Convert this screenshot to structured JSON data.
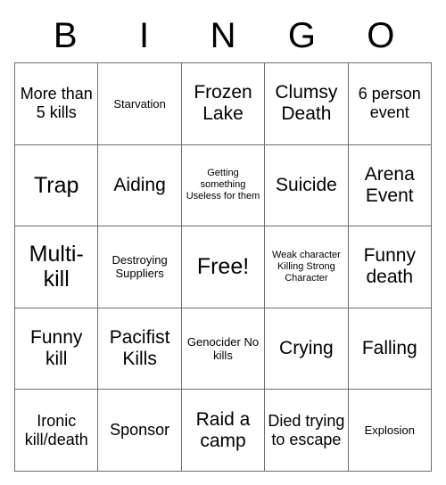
{
  "header": {
    "letters": [
      "B",
      "I",
      "N",
      "G",
      "O"
    ]
  },
  "grid": {
    "rows": 5,
    "columns": 5,
    "border_color": "#6e6e6e",
    "background_color": "#ffffff",
    "text_color": "#000000",
    "free_space_label": "Free!",
    "cells": [
      [
        {
          "text": "More than 5 kills",
          "size": "md"
        },
        {
          "text": "Starvation",
          "size": "sm"
        },
        {
          "text": "Frozen Lake",
          "size": "lg"
        },
        {
          "text": "Clumsy Death",
          "size": "lg"
        },
        {
          "text": "6 person event",
          "size": "md"
        }
      ],
      [
        {
          "text": "Trap",
          "size": "xl"
        },
        {
          "text": "Aiding",
          "size": "lg"
        },
        {
          "text": "Getting something Useless for them",
          "size": "xs"
        },
        {
          "text": "Suicide",
          "size": "lg"
        },
        {
          "text": "Arena Event",
          "size": "lg"
        }
      ],
      [
        {
          "text": "Multi-kill",
          "size": "xl"
        },
        {
          "text": "Destroying Suppliers",
          "size": "sm"
        },
        {
          "text": "Free!",
          "size": "xl"
        },
        {
          "text": "Weak character Killing Strong Character",
          "size": "xs"
        },
        {
          "text": "Funny death",
          "size": "lg"
        }
      ],
      [
        {
          "text": "Funny kill",
          "size": "lg"
        },
        {
          "text": "Pacifist Kills",
          "size": "lg"
        },
        {
          "text": "Genocider No kills",
          "size": "sm"
        },
        {
          "text": "Crying",
          "size": "lg"
        },
        {
          "text": "Falling",
          "size": "lg"
        }
      ],
      [
        {
          "text": "Ironic kill/death",
          "size": "md"
        },
        {
          "text": "Sponsor",
          "size": "md"
        },
        {
          "text": "Raid a camp",
          "size": "lg"
        },
        {
          "text": "Died trying to escape",
          "size": "md"
        },
        {
          "text": "Explosion",
          "size": "sm"
        }
      ]
    ]
  }
}
